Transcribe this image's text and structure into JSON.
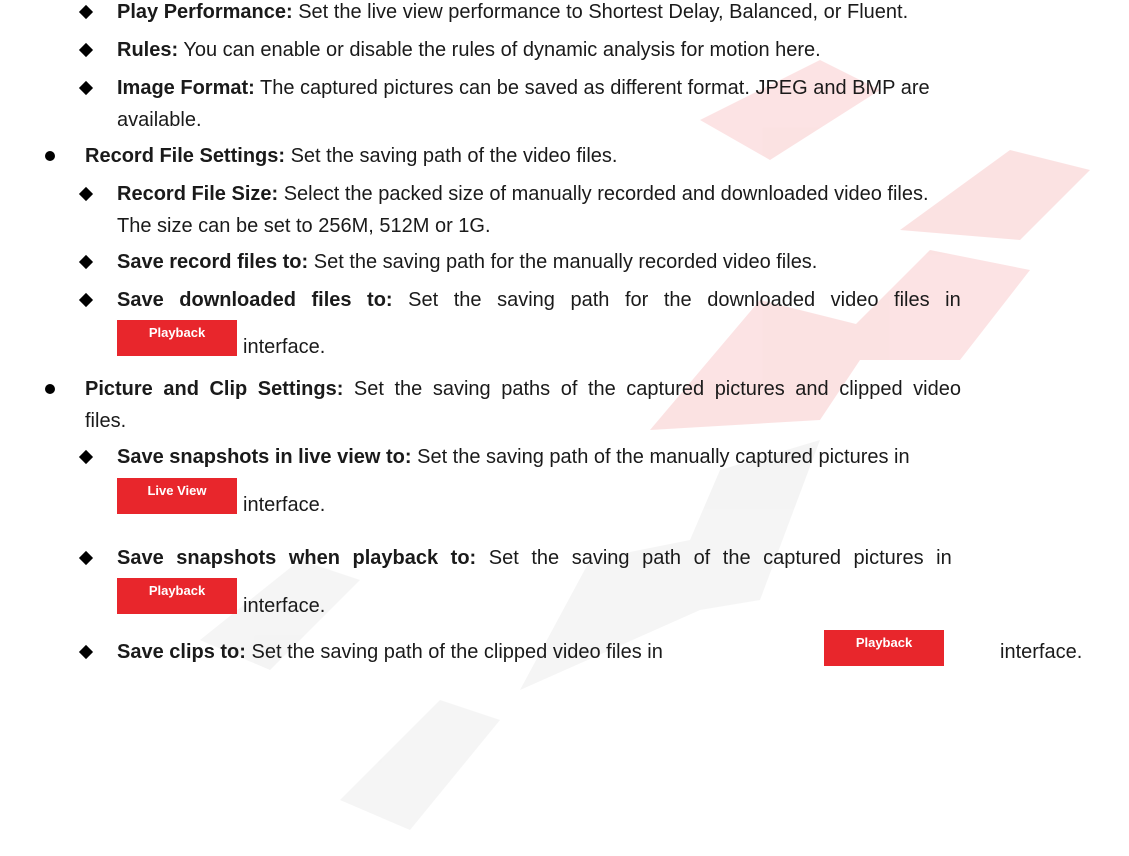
{
  "items": {
    "play_performance": {
      "label": "Play Performance:",
      "text": " Set the live view performance to Shortest Delay, Balanced, or Fluent."
    },
    "rules": {
      "label": "Rules:",
      "text": " You can enable or disable the rules of dynamic analysis for motion here."
    },
    "image_format": {
      "label": "Image Format:",
      "text_line1": " The captured pictures can be saved as different format. JPEG and BMP are",
      "text_line2": "available."
    },
    "record_file_settings": {
      "label": "Record File Settings:",
      "text": " Set the saving path of the video files."
    },
    "record_file_size": {
      "label": "Record File Size:",
      "text_line1": " Select the packed size of manually recorded and downloaded video files.",
      "text_line2": "The size can be set to 256M, 512M or 1G."
    },
    "save_record_files": {
      "label": "Save record files to:",
      "text": " Set the saving path for the manually recorded video files."
    },
    "save_downloaded_files": {
      "label": "Save downloaded files to:",
      "text": " Set the saving path for the downloaded video files in",
      "suffix": "interface."
    },
    "picture_clip_settings": {
      "label": "Picture and Clip Settings:",
      "text_line1": " Set the saving paths of the captured pictures and clipped video",
      "text_line2": "files."
    },
    "save_snapshots_live": {
      "label": "Save snapshots in live view to:",
      "text": " Set the saving path of the manually captured pictures in",
      "suffix": "interface."
    },
    "save_snapshots_playback": {
      "label": "Save snapshots when playback to:",
      "text": " Set the saving path of the captured pictures in",
      "suffix": "interface."
    },
    "save_clips": {
      "label": "Save clips to:",
      "text": " Set the saving path of the clipped video files in",
      "suffix": "interface."
    }
  },
  "buttons": {
    "playback": "Playback",
    "live_view": "Live View"
  },
  "colors": {
    "button_bg": "#e8262c",
    "watermark": "#e8262c"
  }
}
